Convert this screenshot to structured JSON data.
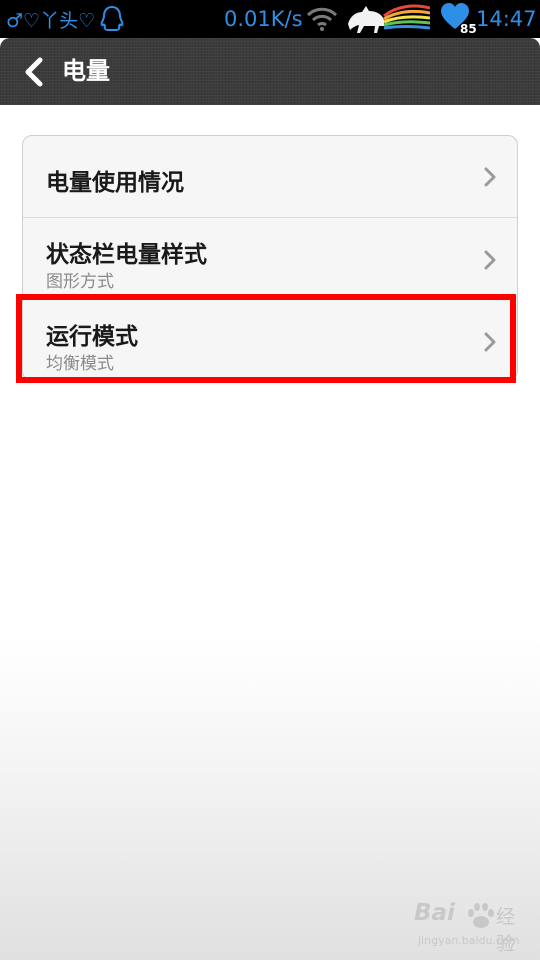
{
  "status_bar": {
    "left_text": "♂♡丫头♡",
    "qq_icon": "qq-penguin-icon",
    "net_speed": "0.01K/s",
    "wifi_icon": "wifi-icon",
    "horse_icon": "rainbow-horse-icon",
    "battery_icon": "heart-battery-icon",
    "battery_level": "85",
    "time": "14:47",
    "text_color": "#2d8fe6"
  },
  "title_bar": {
    "back_icon": "chevron-left-icon",
    "title": "电量"
  },
  "settings": {
    "items": [
      {
        "title": "电量使用情况",
        "subtitle": ""
      },
      {
        "title": "状态栏电量样式",
        "subtitle": "图形方式"
      },
      {
        "title": "运行模式",
        "subtitle": "均衡模式"
      }
    ],
    "chevron_icon": "chevron-right-icon"
  },
  "highlight": {
    "color": "#ff0000",
    "target": "运行模式"
  },
  "watermark": {
    "logo": "Bai",
    "brand": "经验",
    "url": "jingyan.baidu.com"
  }
}
